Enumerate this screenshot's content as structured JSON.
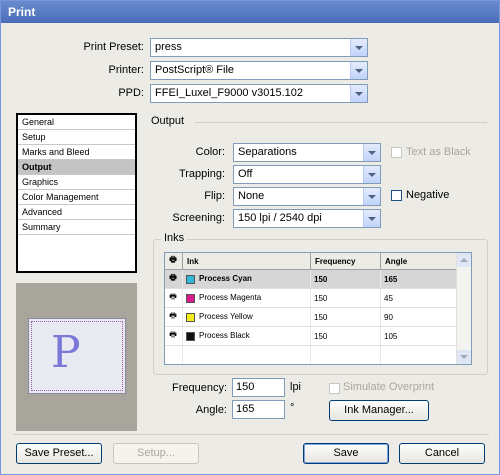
{
  "window": {
    "title": "Print"
  },
  "top": {
    "preset_label": "Print Preset:",
    "preset_value": "press",
    "printer_label": "Printer:",
    "printer_value": "PostScript® File",
    "ppd_label": "PPD:",
    "ppd_value": "FFEI_Luxel_F9000 v3015.102"
  },
  "sidebar": {
    "items": [
      {
        "label": "General"
      },
      {
        "label": "Setup"
      },
      {
        "label": "Marks and Bleed"
      },
      {
        "label": "Output"
      },
      {
        "label": "Graphics"
      },
      {
        "label": "Color Management"
      },
      {
        "label": "Advanced"
      },
      {
        "label": "Summary"
      }
    ],
    "selected": "Output"
  },
  "preview": {
    "glyph": "P"
  },
  "output": {
    "section_title": "Output",
    "color_label": "Color:",
    "color_value": "Separations",
    "text_as_black_label": "Text as Black",
    "text_as_black_checked": false,
    "trapping_label": "Trapping:",
    "trapping_value": "Off",
    "flip_label": "Flip:",
    "flip_value": "None",
    "negative_label": "Negative",
    "negative_checked": false,
    "screening_label": "Screening:",
    "screening_value": "150 lpi / 2540 dpi"
  },
  "inks": {
    "group_label": "Inks",
    "columns": [
      "Ink",
      "Frequency",
      "Angle"
    ],
    "rows": [
      {
        "name": "Process Cyan",
        "frequency": "150",
        "angle": "165",
        "color": "#2fb8d8",
        "selected": true
      },
      {
        "name": "Process Magenta",
        "frequency": "150",
        "angle": "45",
        "color": "#d81a8c",
        "selected": false
      },
      {
        "name": "Process Yellow",
        "frequency": "150",
        "angle": "90",
        "color": "#f4ea1c",
        "selected": false
      },
      {
        "name": "Process Black",
        "frequency": "150",
        "angle": "105",
        "color": "#111111",
        "selected": false
      }
    ],
    "frequency_label": "Frequency:",
    "frequency_value": "150",
    "frequency_unit": "lpi",
    "angle_label": "Angle:",
    "angle_value": "165",
    "angle_unit": "°",
    "simulate_overprint_label": "Simulate Overprint",
    "ink_manager_label": "Ink Manager..."
  },
  "buttons": {
    "save_preset": "Save Preset...",
    "setup": "Setup...",
    "save": "Save",
    "cancel": "Cancel"
  }
}
